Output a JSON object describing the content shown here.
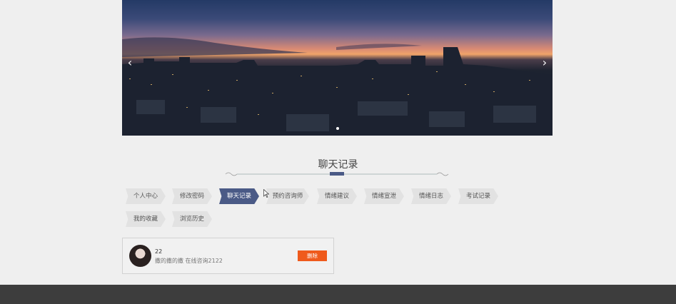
{
  "banner": {
    "prev_icon": "chevron-left-icon",
    "next_icon": "chevron-right-icon",
    "prev_glyph": "‹",
    "next_glyph": "›"
  },
  "section": {
    "title": "聊天记录"
  },
  "tabs": [
    {
      "label": "个人中心"
    },
    {
      "label": "修改密码"
    },
    {
      "label": "聊天记录",
      "active": true
    },
    {
      "label": "预约咨询师"
    },
    {
      "label": "情绪建议"
    },
    {
      "label": "情绪宣泄"
    },
    {
      "label": "情绪日志"
    },
    {
      "label": "考试记录"
    },
    {
      "label": "我的收藏"
    },
    {
      "label": "浏览历史"
    }
  ],
  "chat_records": [
    {
      "name": "22",
      "message": "撒的撒的撒 在线咨询2122",
      "delete_label": "删除"
    }
  ],
  "colors": {
    "active_tab": "#4a5a86",
    "delete_button": "#ef5a1c",
    "footer": "#3d3d3d"
  }
}
